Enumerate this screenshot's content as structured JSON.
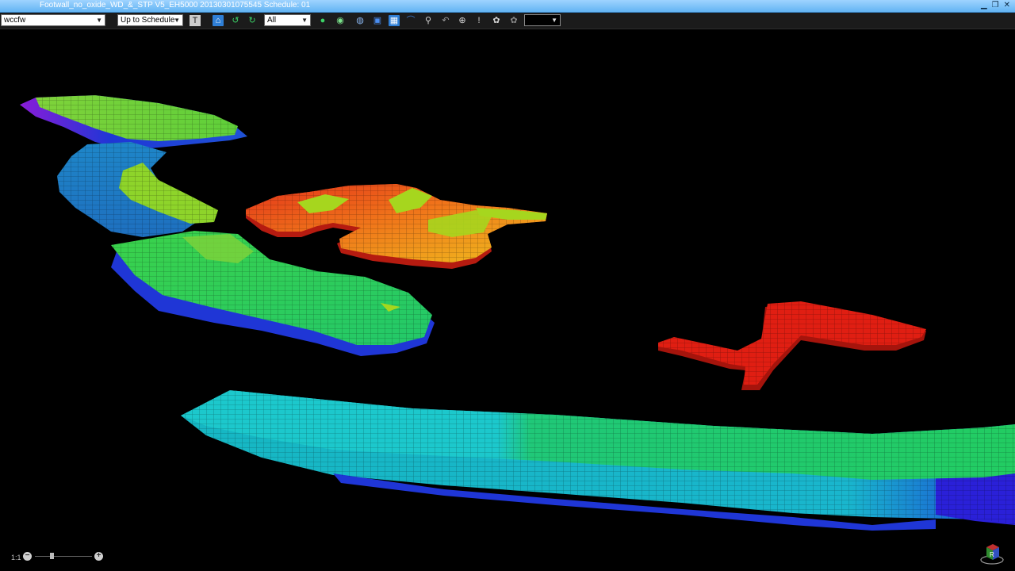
{
  "window": {
    "title": "Footwall_no_oxide_WD_&_STP V5_EH5000  20130301075545   Schedule: 01"
  },
  "toolbar": {
    "model_select": "wccfw",
    "schedule_select": "Up to Schedule",
    "filter_select": "All",
    "icons": [
      "text-icon",
      "view-top-icon",
      "rotate-left-icon",
      "rotate-right-icon",
      "globe-green-icon",
      "globe-white-icon",
      "sphere-icon",
      "cube-icon",
      "select-box-icon",
      "arc-icon",
      "location-pin-icon",
      "refresh-icon",
      "target-icon",
      "marker-icon",
      "paw-icon",
      "paw-gray-icon",
      "color-picker-icon"
    ],
    "active_color": "#000000"
  },
  "viewport": {
    "description_hidden": true,
    "palette": {
      "red": "#e01e12",
      "orange": "#f0741a",
      "yellow_orange": "#f0b81e",
      "yellow_green": "#a6d61e",
      "green": "#28d24f",
      "teal": "#16c6c4",
      "blue_teal": "#1e86c8",
      "blue": "#1f36d6",
      "violet": "#8a1cd8"
    }
  },
  "zoom": {
    "ratio_label": "1:1",
    "level_fraction": 0.25
  }
}
